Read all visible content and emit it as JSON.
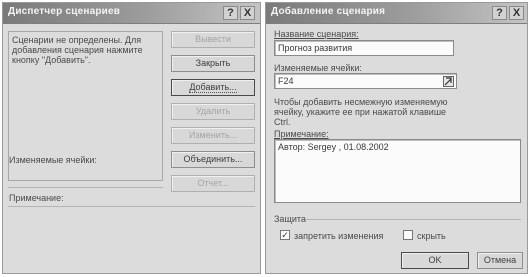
{
  "manager": {
    "title": "Диспетчер сценариев",
    "help_label": "?",
    "close_label": "X",
    "scenarios_message": "Сценарии не определены. Для добавления сценария нажмите кнопку \"Добавить\".",
    "buttons": {
      "show": "Вывести",
      "close": "Закрыть",
      "add": "Добавить...",
      "delete": "Удалить",
      "edit": "Изменить...",
      "merge": "Объединить...",
      "report": "Отчет..."
    },
    "changing_cells_label": "Изменяемые ячейки:",
    "comment_label": "Примечание:"
  },
  "add_scenario": {
    "title": "Добавление сценария",
    "help_label": "?",
    "close_label": "X",
    "name_label": "Название сценария:",
    "name_value": "Прогноз развития",
    "changing_cells_label": "Изменяемые ячейки:",
    "changing_cells_value": "F24",
    "hint": "Чтобы добавить несмежную изменяемую ячейку, укажите ее при нажатой клавише Ctrl.",
    "comment_label": "Примечание:",
    "comment_value": "Автор: Sergey , 01.08.2002",
    "protection_label": "Защита",
    "prevent_changes_label": "запретить изменения",
    "prevent_changes_checked": "✓",
    "hide_label": "скрыть",
    "ok_label": "OK",
    "cancel_label": "Отмена"
  }
}
